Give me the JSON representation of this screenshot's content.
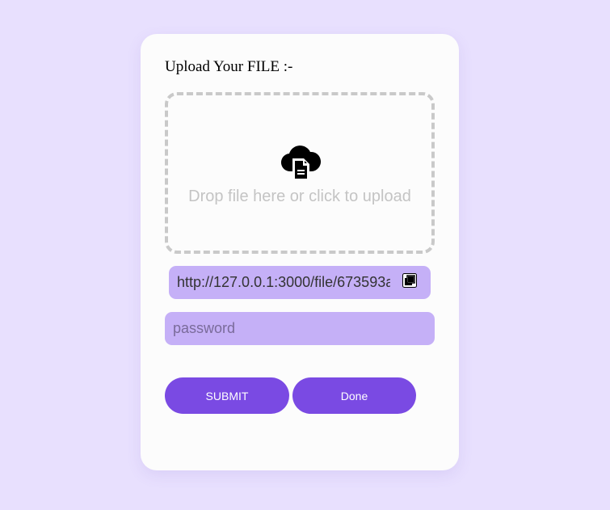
{
  "upload": {
    "heading": "Upload Your FILE :-",
    "dropzone_text": "Drop file here or click to upload",
    "icon": "cloud-file-upload-icon"
  },
  "link": {
    "value": "http://127.0.0.1:3000/file/673593a",
    "copy_icon": "copy-icon"
  },
  "password": {
    "placeholder": "password",
    "value": ""
  },
  "buttons": {
    "submit_label": "SUBMIT",
    "done_label": "Done"
  },
  "colors": {
    "page_background": "#e8e0fe",
    "card_background": "#fcfcfc",
    "input_background": "#c5b0f7",
    "button_background": "#7a4ae3",
    "dropzone_border": "#c9c9c9"
  }
}
